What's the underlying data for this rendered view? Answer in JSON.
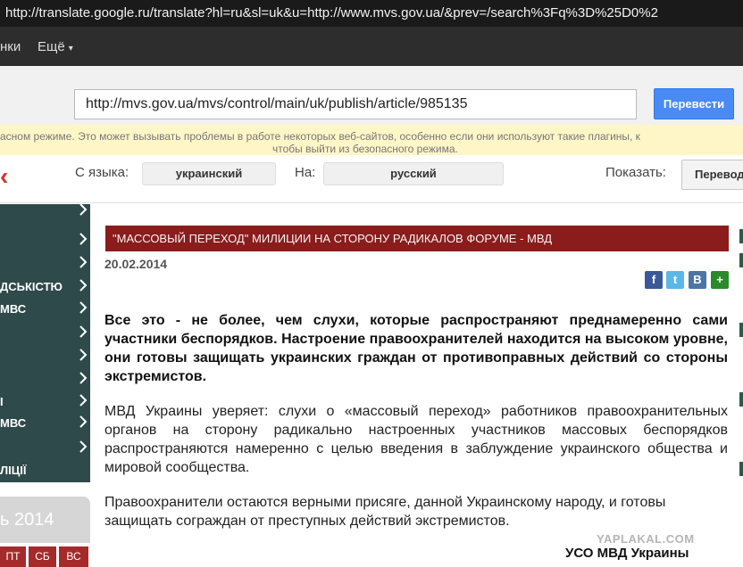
{
  "browser": {
    "url": "http://translate.google.ru/translate?hl=ru&sl=uk&u=http://www.mvs.gov.ua/&prev=/search%3Fq%3D%25D0%2"
  },
  "google_bar": {
    "item1": "нки",
    "item2": "Ещё"
  },
  "translate_form": {
    "url_value": "http://mvs.gov.ua/mvs/control/main/uk/publish/article/985135",
    "button": "Перевести"
  },
  "warning": {
    "line1": "асном режиме. Это может вызывать проблемы в работе некоторых веб-сайтов, особенно если они используют такие плагины, к",
    "line2": "чтобы выйти из безопасного режима."
  },
  "language_bar": {
    "from_label": "С языка:",
    "from_value": "украинский",
    "to_label": "На:",
    "to_value": "русский",
    "show_label": "Показать:",
    "show_button": "Перевод"
  },
  "sidebar": {
    "items": [
      {
        "label": ""
      },
      {
        "label": ""
      },
      {
        "label": ""
      },
      {
        "label": "ДСЬКІСТЮ"
      },
      {
        "label": "МВС"
      },
      {
        "label": ""
      },
      {
        "label": ""
      },
      {
        "label": ""
      },
      {
        "label": "І"
      },
      {
        "label": "МВС"
      },
      {
        "label": ""
      },
      {
        "label": "ЛІЦІЇ"
      }
    ],
    "calendar_year": "ь 2014",
    "calendar_days": [
      "ПТ",
      "СБ",
      "ВС"
    ]
  },
  "article": {
    "title": "\"МАССОВЫЙ ПЕРЕХОД\" МИЛИЦИИ НА СТОРОНУ РАДИКАЛОВ ФОРУМЕ - МВД",
    "date": "20.02.2014",
    "share": {
      "fb": "f",
      "tw": "t",
      "vk": "B",
      "plus": "+"
    },
    "lead": "Все это - не более, чем слухи, которые распространяют преднамеренно сами участники беспорядков. Настроение правоохранителей находится на высоком уровне, они готовы защищать украинских граждан от противоправных действий со стороны экстремистов.",
    "para1": "МВД Украины уверяет: слухи о «массовый переход» работников правоохранительных органов на сторону радикально настроенных участников массовых беспорядков распространяются намеренно с целью введения в заблуждение украинского общества и мировой сообщества.",
    "para2": "Правоохранители остаются верными присяге, данной Украинскому народу, и готовы защищать сограждан от преступных действий экстремистов.",
    "signature": "УСО МВД Украины"
  },
  "watermark": "YAPLAKAL.COM",
  "colors": {
    "title_bar": "#8a1c1c",
    "sidebar": "#2f4a4a",
    "translate_button": "#4a8af4",
    "warning_bg": "#fff6c8"
  }
}
